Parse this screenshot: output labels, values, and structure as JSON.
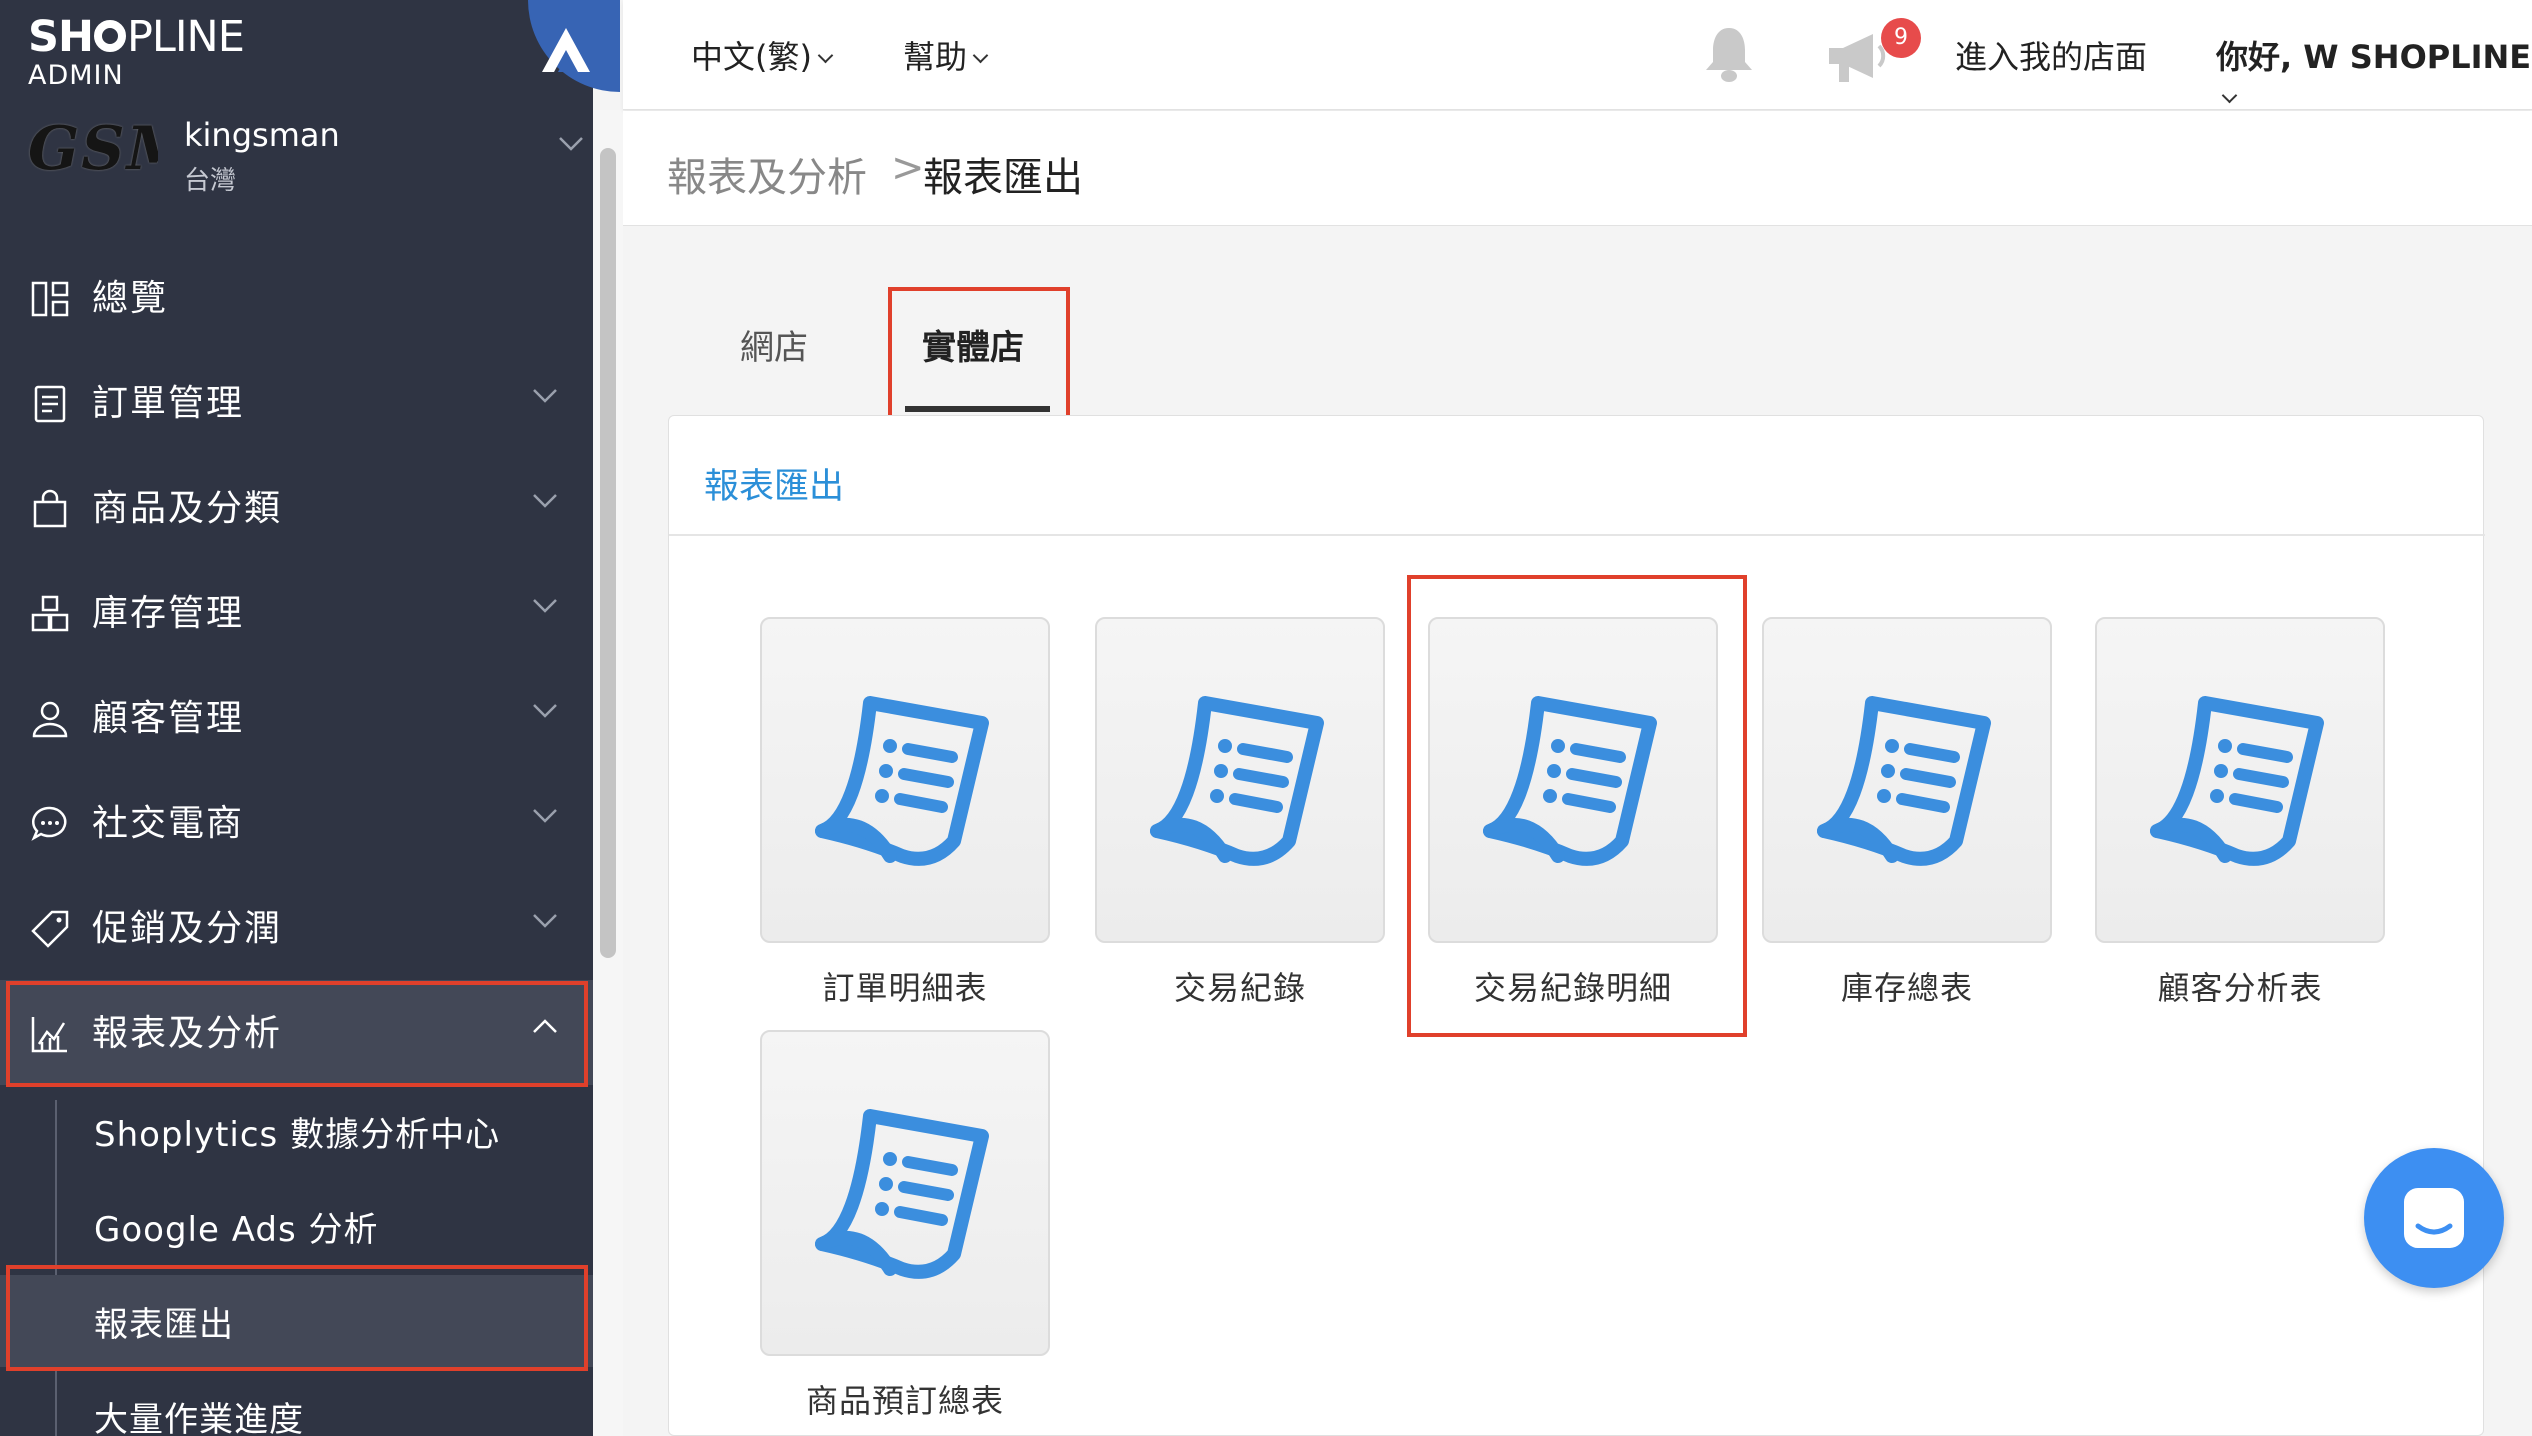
{
  "brand": {
    "logo_bold": "SH",
    "logo_rest": "PLINE",
    "admin": "ADMIN"
  },
  "store": {
    "logo_text": "GSM",
    "name": "kingsman",
    "region": "台灣"
  },
  "sidebar": {
    "items": [
      {
        "label": "總覽",
        "icon": "dashboard-icon"
      },
      {
        "label": "訂單管理",
        "icon": "order-list-icon"
      },
      {
        "label": "商品及分類",
        "icon": "shopping-bag-icon"
      },
      {
        "label": "庫存管理",
        "icon": "inventory-icon"
      },
      {
        "label": "顧客管理",
        "icon": "user-icon"
      },
      {
        "label": "社交電商",
        "icon": "chat-bubble-icon"
      },
      {
        "label": "促銷及分潤",
        "icon": "tag-icon"
      },
      {
        "label": "報表及分析",
        "icon": "chart-icon"
      }
    ],
    "subitems": [
      {
        "label": "Shoplytics 數據分析中心"
      },
      {
        "label": "Google Ads 分析"
      },
      {
        "label": "報表匯出"
      },
      {
        "label": "大量作業進度"
      }
    ]
  },
  "topbar": {
    "language": "中文(繁)",
    "help": "幫助",
    "notification_count": "9",
    "enter_store": "進入我的店面",
    "greeting": "你好, W SHOPLINE"
  },
  "breadcrumb": {
    "parent": "報表及分析",
    "separator": ">",
    "current": "報表匯出"
  },
  "tabs": [
    {
      "label": "網店"
    },
    {
      "label": "實體店"
    }
  ],
  "card": {
    "title": "報表匯出",
    "reports": [
      {
        "label": "訂單明細表"
      },
      {
        "label": "交易紀錄"
      },
      {
        "label": "交易紀錄明細"
      },
      {
        "label": "庫存總表"
      },
      {
        "label": "顧客分析表"
      },
      {
        "label": "商品預訂總表"
      }
    ]
  },
  "colors": {
    "sidebar_bg": "#2f3443",
    "sidebar_active": "#434857",
    "accent_blue": "#2b8fd8",
    "icon_blue": "#3b8ede",
    "highlight_red": "#e0402b",
    "badge_red": "#e74b4b",
    "chat_blue": "#3d8ff2"
  }
}
